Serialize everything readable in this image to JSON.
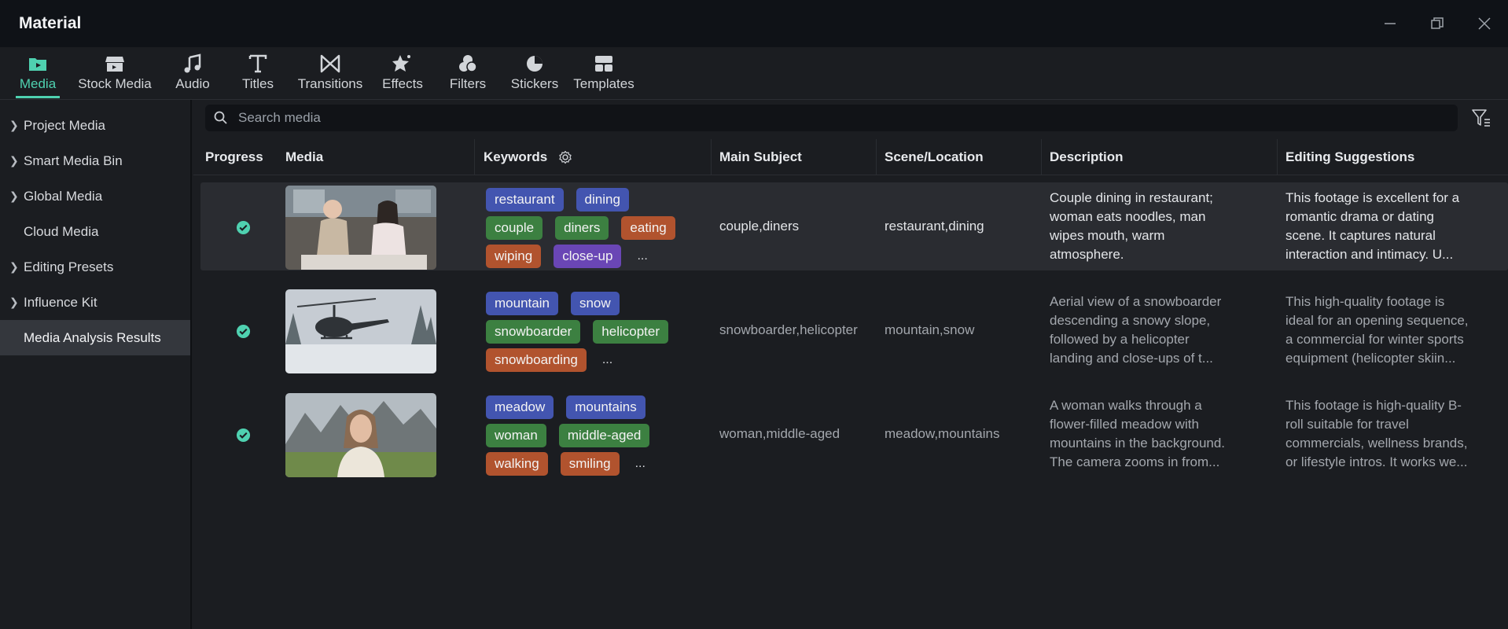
{
  "window": {
    "title": "Material"
  },
  "toolbar": {
    "items": [
      {
        "label": "Media",
        "icon": "media-folder-icon",
        "active": true
      },
      {
        "label": "Stock Media",
        "icon": "store-icon"
      },
      {
        "label": "Audio",
        "icon": "music-note-icon"
      },
      {
        "label": "Titles",
        "icon": "text-t-icon"
      },
      {
        "label": "Transitions",
        "icon": "bowtie-transition-icon"
      },
      {
        "label": "Effects",
        "icon": "star-effect-icon"
      },
      {
        "label": "Filters",
        "icon": "filter-circles-icon"
      },
      {
        "label": "Stickers",
        "icon": "pie-sticker-icon"
      },
      {
        "label": "Templates",
        "icon": "template-grid-icon"
      }
    ],
    "accent_color": "#4fd1b0"
  },
  "sidebar": {
    "items": [
      {
        "label": "Project Media",
        "expandable": true
      },
      {
        "label": "Smart Media Bin",
        "expandable": true
      },
      {
        "label": "Global Media",
        "expandable": true
      },
      {
        "label": "Cloud Media",
        "expandable": false
      },
      {
        "label": "Editing Presets",
        "expandable": true
      },
      {
        "label": "Influence Kit",
        "expandable": true
      },
      {
        "label": "Media Analysis Results",
        "expandable": false,
        "selected": true
      }
    ]
  },
  "search": {
    "placeholder": "Search media",
    "value": ""
  },
  "table": {
    "headers": {
      "progress": "Progress",
      "media": "Media",
      "keywords": "Keywords",
      "main_subject": "Main Subject",
      "scene": "Scene/Location",
      "description": "Description",
      "suggestions": "Editing Suggestions"
    },
    "rows": [
      {
        "status": "complete",
        "thumbnail": "couple-dining-restaurant",
        "tags": [
          [
            {
              "text": "restaurant",
              "color": "blue"
            },
            {
              "text": "dining",
              "color": "blue"
            }
          ],
          [
            {
              "text": "couple",
              "color": "green"
            },
            {
              "text": "diners",
              "color": "green"
            },
            {
              "text": "eating",
              "color": "orange"
            }
          ],
          [
            {
              "text": "wiping",
              "color": "orange"
            },
            {
              "text": "close-up",
              "color": "purple"
            }
          ]
        ],
        "more": "...",
        "main_subject": "couple,diners",
        "scene": "restaurant,dining",
        "description": [
          "Couple dining in restaurant;",
          "woman eats noodles, man",
          "wipes mouth, warm",
          "atmosphere."
        ],
        "suggestions": [
          "This footage is excellent for a",
          "romantic drama or dating",
          "scene. It captures natural",
          "interaction and intimacy. U..."
        ]
      },
      {
        "status": "complete",
        "thumbnail": "helicopter-snow-mountain",
        "tags": [
          [
            {
              "text": "mountain",
              "color": "blue"
            },
            {
              "text": "snow",
              "color": "blue"
            }
          ],
          [
            {
              "text": "snowboarder",
              "color": "green"
            },
            {
              "text": "helicopter",
              "color": "green"
            }
          ],
          [
            {
              "text": "snowboarding",
              "color": "orange"
            }
          ]
        ],
        "more": "...",
        "main_subject": "snowboarder,helicopter",
        "scene": "mountain,snow",
        "description": [
          "Aerial view of a snowboarder",
          "descending a snowy slope,",
          "followed by a helicopter",
          "landing and close-ups of t..."
        ],
        "suggestions": [
          "This high-quality footage is",
          "ideal for an opening sequence,",
          "a commercial for winter sports",
          "equipment (helicopter skiin..."
        ]
      },
      {
        "status": "complete",
        "thumbnail": "woman-meadow-mountains",
        "tags": [
          [
            {
              "text": "meadow",
              "color": "blue"
            },
            {
              "text": "mountains",
              "color": "blue"
            }
          ],
          [
            {
              "text": "woman",
              "color": "green"
            },
            {
              "text": "middle-aged",
              "color": "green"
            }
          ],
          [
            {
              "text": "walking",
              "color": "orange"
            },
            {
              "text": "smiling",
              "color": "orange"
            }
          ]
        ],
        "more": "...",
        "main_subject": "woman,middle-aged",
        "scene": "meadow,mountains",
        "description": [
          "A woman walks through a",
          "flower-filled meadow with",
          "mountains in the background.",
          "The camera zooms in from..."
        ],
        "suggestions": [
          "This footage is high-quality B-",
          "roll suitable for travel",
          "commercials, wellness brands,",
          "or lifestyle intros. It works we..."
        ]
      }
    ]
  }
}
